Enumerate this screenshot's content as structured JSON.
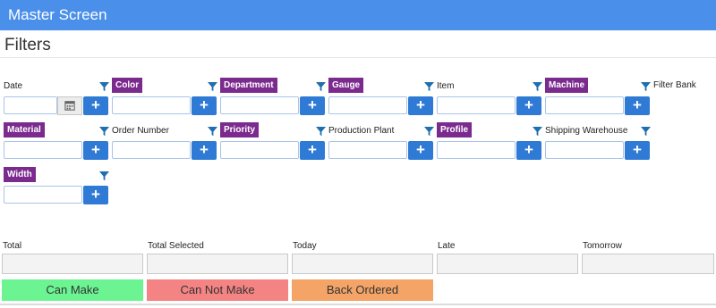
{
  "window": {
    "title": "Master Screen"
  },
  "section_title": "Filters",
  "filters": [
    {
      "label": "Date",
      "highlight": false
    },
    {
      "label": "Color",
      "highlight": true
    },
    {
      "label": "Department",
      "highlight": true
    },
    {
      "label": "Gauge",
      "highlight": true
    },
    {
      "label": "Item",
      "highlight": false
    },
    {
      "label": "Machine",
      "highlight": true
    },
    {
      "label": "Material",
      "highlight": true
    },
    {
      "label": "Order Number",
      "highlight": false
    },
    {
      "label": "Priority",
      "highlight": true
    },
    {
      "label": "Production Plant",
      "highlight": false
    },
    {
      "label": "Profile",
      "highlight": true
    },
    {
      "label": "Shipping Warehouse",
      "highlight": false
    },
    {
      "label": "Width",
      "highlight": true
    }
  ],
  "filter_bank_label": "Filter Bank",
  "add_label": "+",
  "icons": {
    "filter": "funnel-icon",
    "calendar": "calendar-icon"
  },
  "totals": [
    {
      "label": "Total",
      "value": ""
    },
    {
      "label": "Total Selected",
      "value": ""
    },
    {
      "label": "Today",
      "value": ""
    },
    {
      "label": "Late",
      "value": ""
    },
    {
      "label": "Tomorrow",
      "value": ""
    }
  ],
  "status_buttons": [
    {
      "label": "Can Make",
      "color": "#6cf493"
    },
    {
      "label": "Can Not Make",
      "color": "#f48383"
    },
    {
      "label": "Back Ordered",
      "color": "#f3a466"
    }
  ],
  "colors": {
    "header": "#4a8fe9",
    "highlight_label": "#7b2a8e",
    "add_button": "#2f7ad4",
    "funnel": "#1f6fb0"
  }
}
